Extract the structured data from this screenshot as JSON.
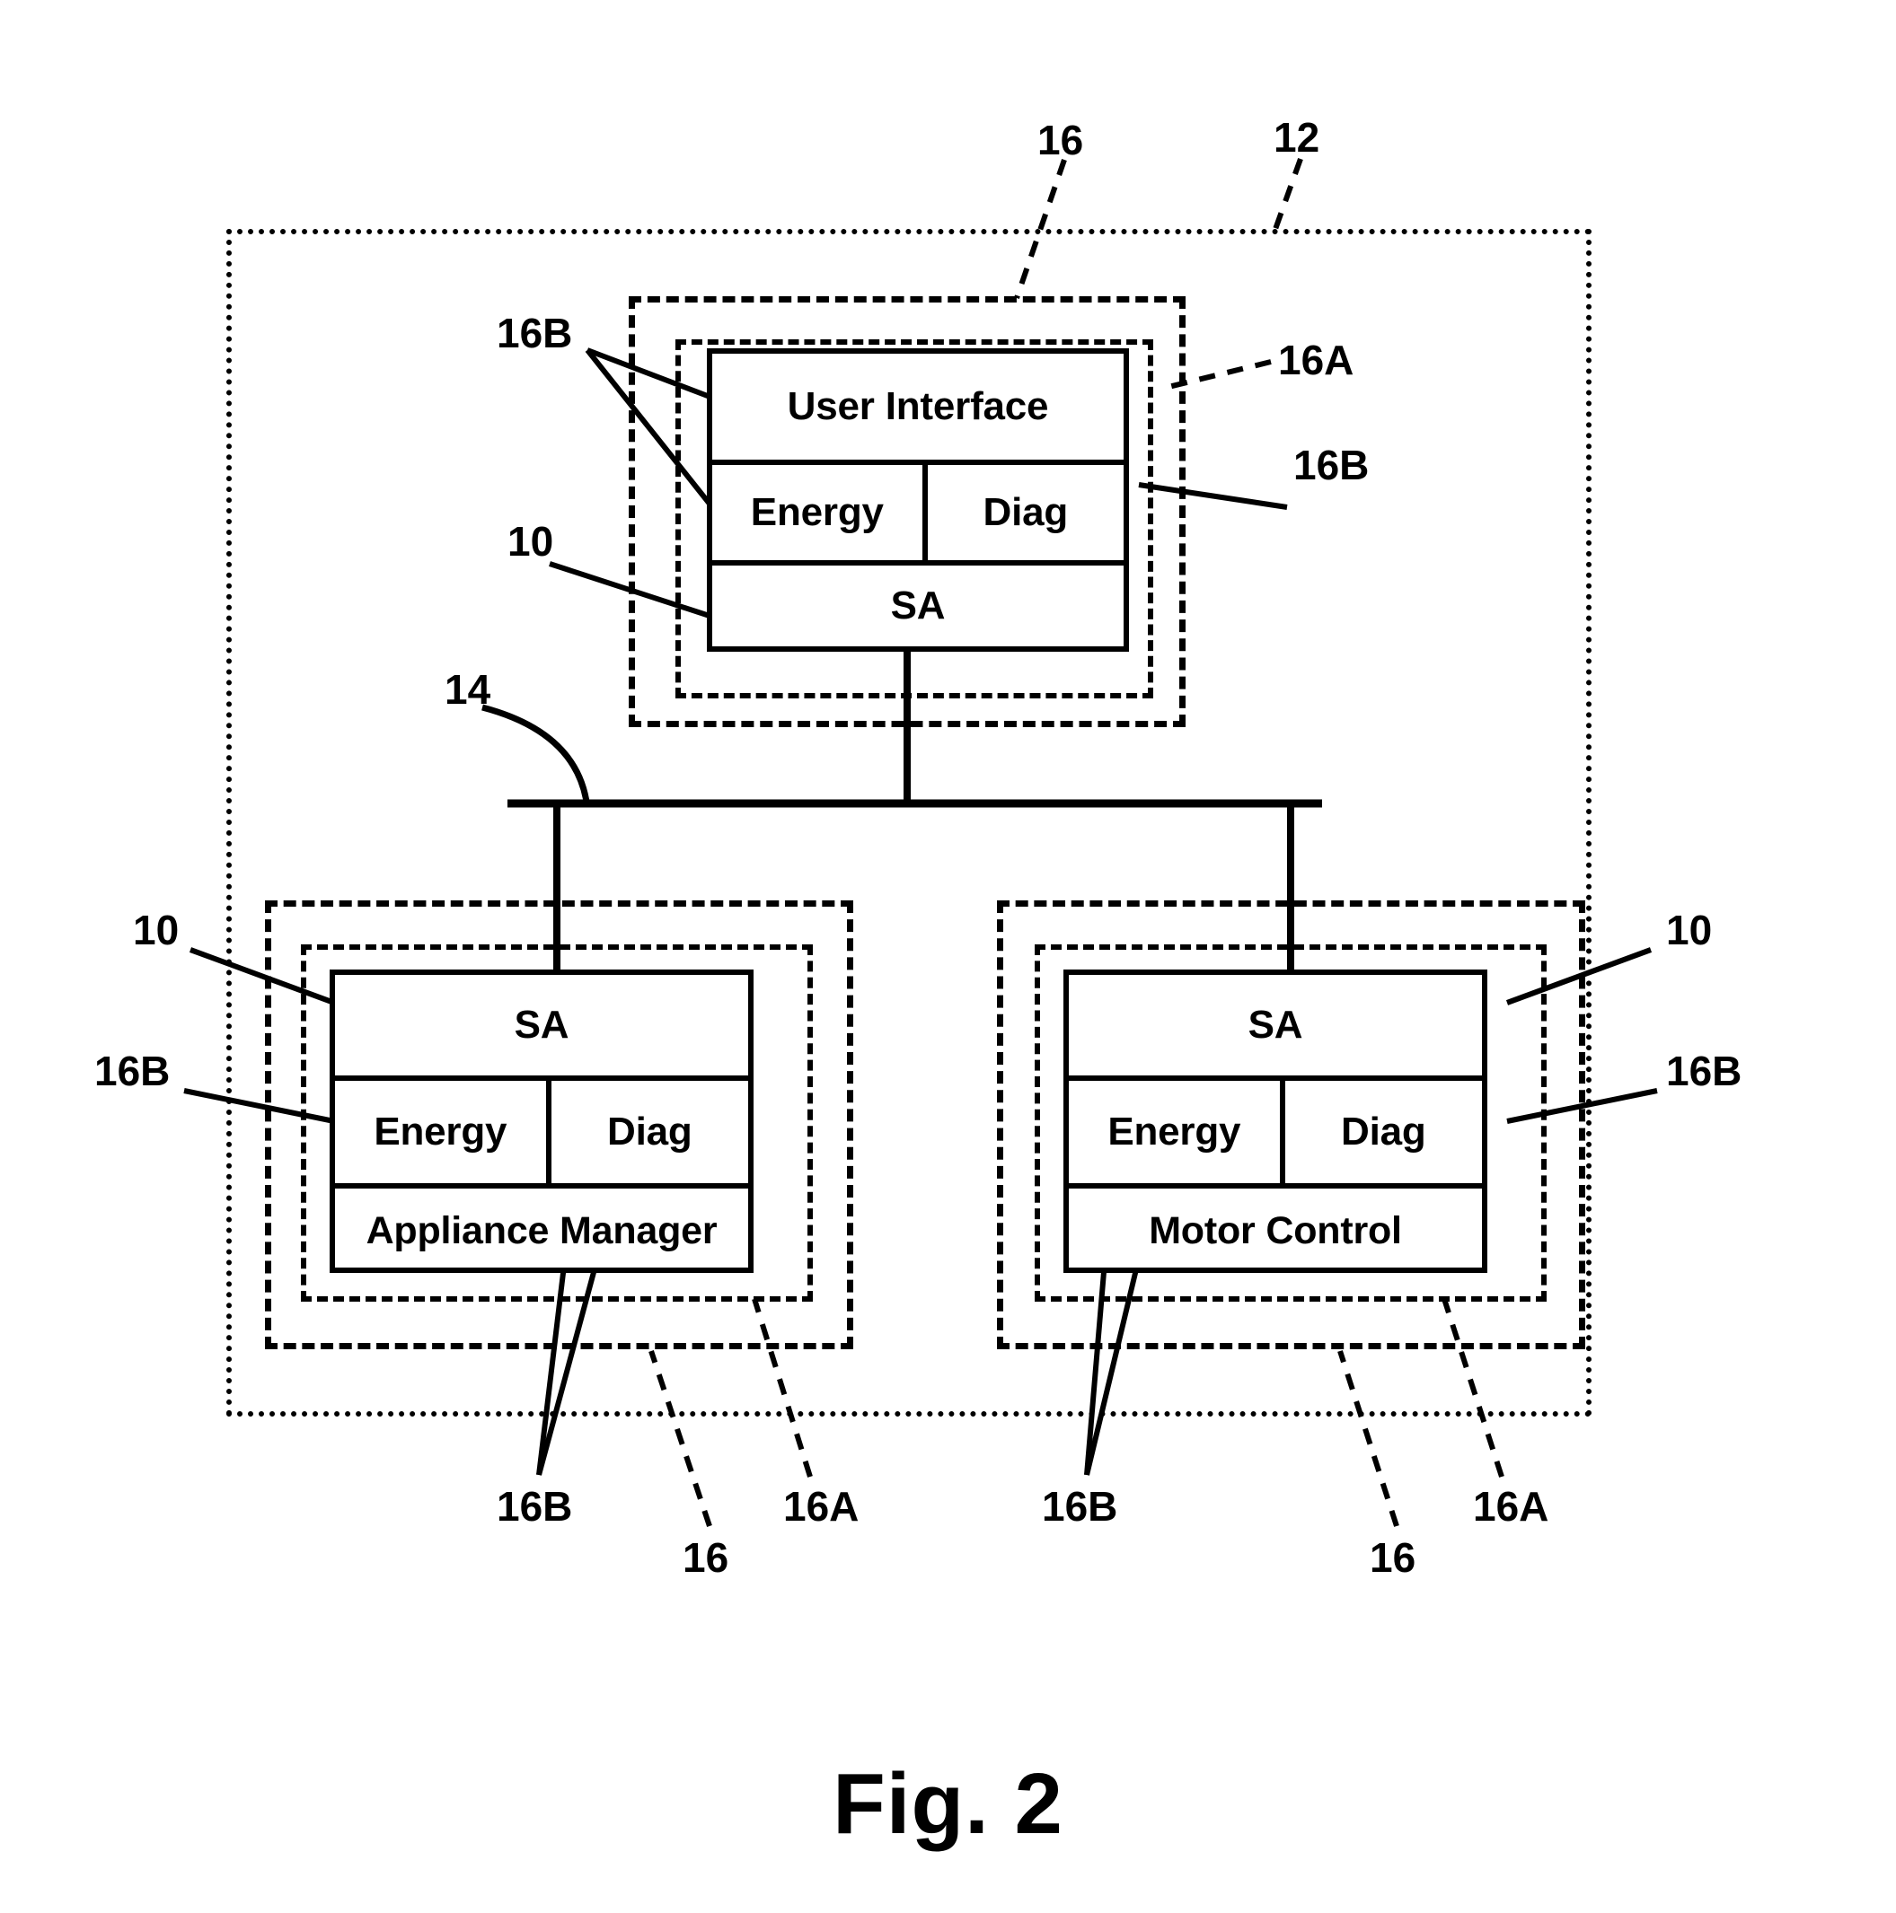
{
  "figure": {
    "caption": "Fig. 2",
    "background_color": "#ffffff",
    "line_color": "#000000"
  },
  "enclosures": {
    "outer_system": {
      "ref": "12",
      "style": "dotted"
    },
    "ui_node_16": {
      "ref": "16",
      "style": "dashed"
    },
    "ui_node_16a": {
      "ref": "16A",
      "style": "dashed"
    },
    "left_node_16": {
      "ref": "16",
      "style": "dashed"
    },
    "left_node_16a": {
      "ref": "16A",
      "style": "dashed"
    },
    "right_node_16": {
      "ref": "16",
      "style": "dashed"
    },
    "right_node_16a": {
      "ref": "16A",
      "style": "dashed"
    }
  },
  "bus": {
    "ref": "14"
  },
  "blocks": {
    "ui_node": {
      "rows": [
        {
          "cells": [
            {
              "label": "User Interface"
            }
          ]
        },
        {
          "cells": [
            {
              "label": "Energy"
            },
            {
              "label": "Diag"
            }
          ]
        },
        {
          "cells": [
            {
              "label": "SA"
            }
          ]
        }
      ]
    },
    "left_node": {
      "rows": [
        {
          "cells": [
            {
              "label": "SA"
            }
          ]
        },
        {
          "cells": [
            {
              "label": "Energy"
            },
            {
              "label": "Diag"
            }
          ]
        },
        {
          "cells": [
            {
              "label": "Appliance Manager"
            }
          ]
        }
      ]
    },
    "right_node": {
      "rows": [
        {
          "cells": [
            {
              "label": "SA"
            }
          ]
        },
        {
          "cells": [
            {
              "label": "Energy"
            },
            {
              "label": "Diag"
            }
          ]
        },
        {
          "cells": [
            {
              "label": "Motor Control"
            }
          ]
        }
      ]
    }
  },
  "refs": {
    "top_16": "16",
    "top_12": "12",
    "ui_16b_left": "16B",
    "ui_16a_right": "16A",
    "ui_16b_right": "16B",
    "ui_10": "10",
    "bus_14": "14",
    "left_10": "10",
    "left_16b": "16B",
    "right_10": "10",
    "right_16b": "16B",
    "bottom_left_16b": "16B",
    "bottom_left_16": "16",
    "bottom_left_16a": "16A",
    "bottom_right_16b": "16B",
    "bottom_right_16": "16",
    "bottom_right_16a": "16A"
  }
}
